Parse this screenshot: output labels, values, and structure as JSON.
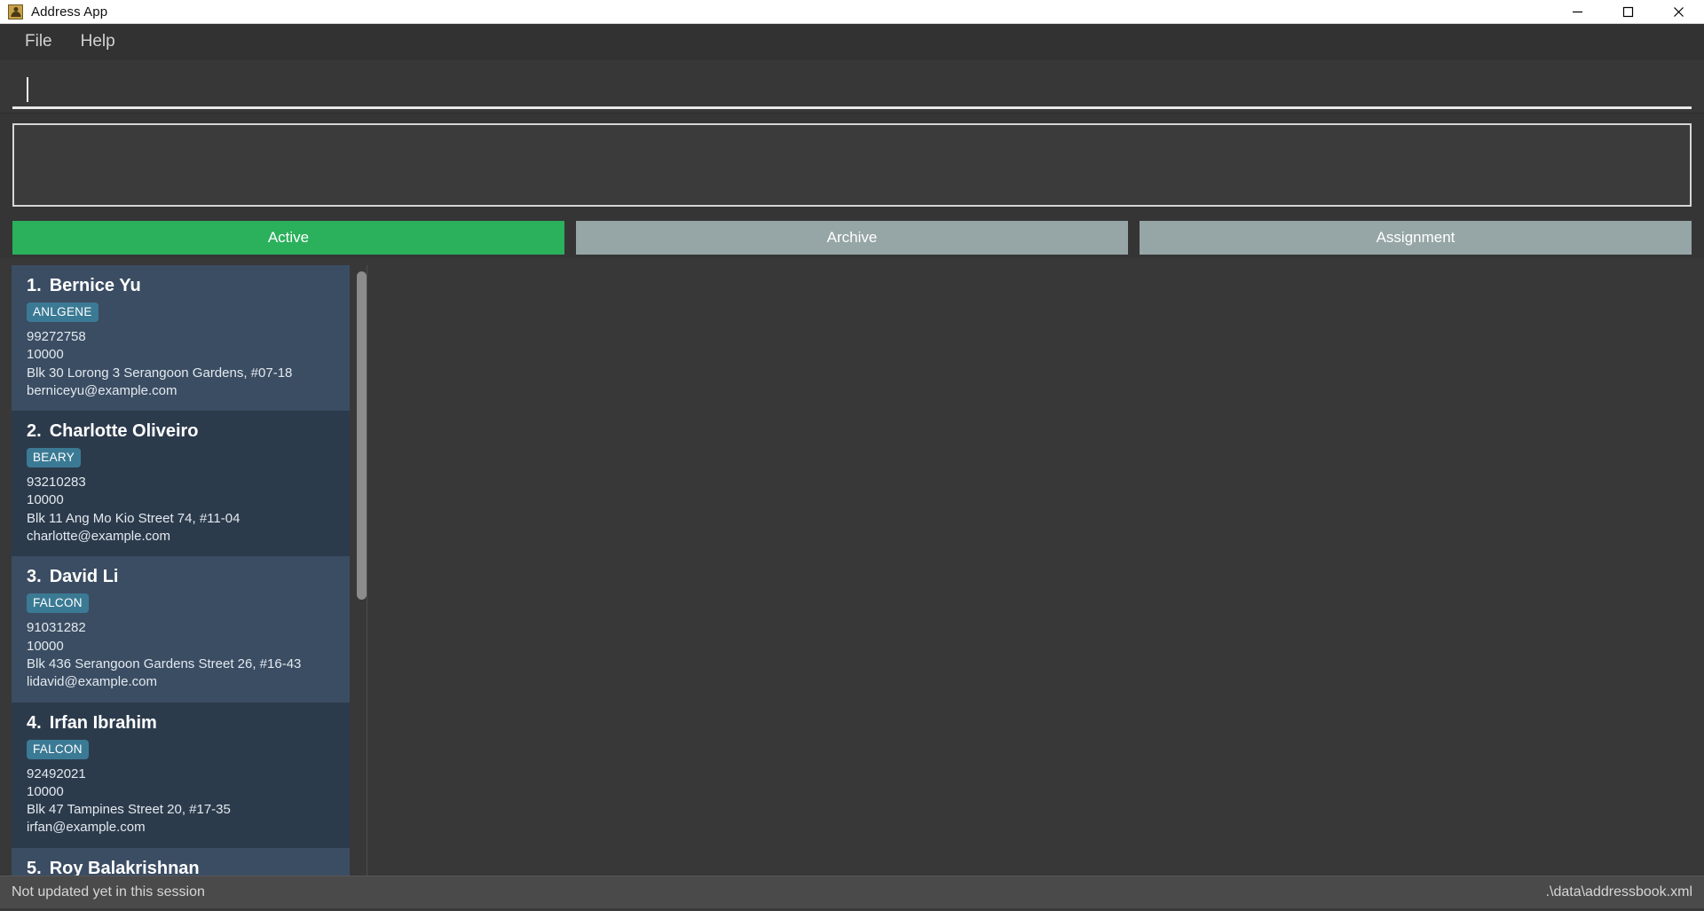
{
  "window": {
    "title": "Address App",
    "icon": "person-card-icon",
    "controls": [
      {
        "name": "minimize",
        "glyph": "—"
      },
      {
        "name": "maximize",
        "glyph": "□"
      },
      {
        "name": "close",
        "glyph": "✕"
      }
    ]
  },
  "menubar": {
    "items": [
      {
        "label": "File"
      },
      {
        "label": "Help"
      }
    ]
  },
  "command": {
    "value": "",
    "placeholder": ""
  },
  "result": {
    "text": ""
  },
  "tabs": [
    {
      "label": "Active",
      "state": "active"
    },
    {
      "label": "Archive",
      "state": "inactive"
    },
    {
      "label": "Assignment",
      "state": "inactive"
    }
  ],
  "colors": {
    "tab_active": "#2bb05c",
    "tab_inactive": "#96a5a5",
    "badge": "#3b7a94",
    "card_odd": "#3b4d63",
    "card_even": "#2c3b4c",
    "app_background": "#383838",
    "titlebar": "#ffffff"
  },
  "person_list": [
    {
      "index": "1.",
      "name": "Bernice Yu",
      "tag": "ANLGENE",
      "phone": "99272758",
      "number": "10000",
      "address": "Blk 30 Lorong 3 Serangoon Gardens, #07-18",
      "email": "berniceyu@example.com"
    },
    {
      "index": "2.",
      "name": "Charlotte Oliveiro",
      "tag": "BEARY",
      "phone": "93210283",
      "number": "10000",
      "address": "Blk 11 Ang Mo Kio Street 74, #11-04",
      "email": "charlotte@example.com"
    },
    {
      "index": "3.",
      "name": "David Li",
      "tag": "FALCON",
      "phone": "91031282",
      "number": "10000",
      "address": "Blk 436 Serangoon Gardens Street 26, #16-43",
      "email": "lidavid@example.com"
    },
    {
      "index": "4.",
      "name": "Irfan Ibrahim",
      "tag": "FALCON",
      "phone": "92492021",
      "number": "10000",
      "address": "Blk 47 Tampines Street 20, #17-35",
      "email": "irfan@example.com"
    },
    {
      "index": "5.",
      "name": "Roy Balakrishnan",
      "tag": "",
      "phone": "",
      "number": "",
      "address": "",
      "email": ""
    }
  ],
  "statusbar": {
    "left": "Not updated yet in this session",
    "right": ".\\data\\addressbook.xml"
  }
}
